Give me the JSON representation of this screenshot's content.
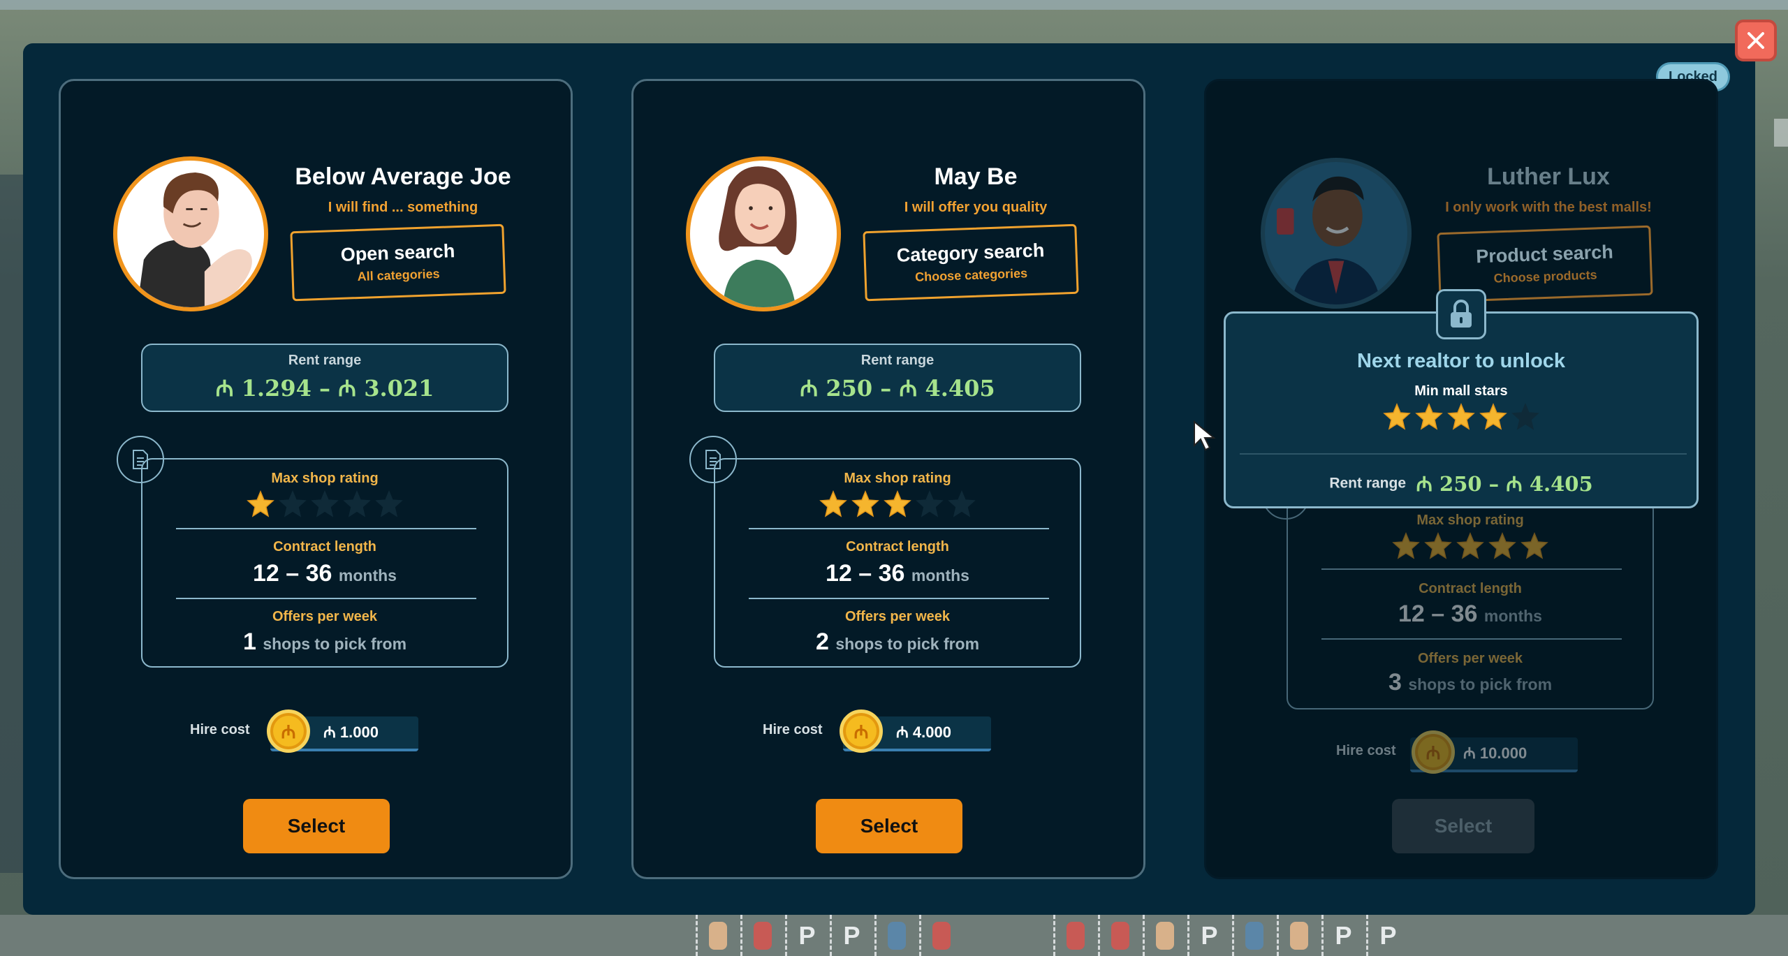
{
  "header": {
    "locked_badge": "Locked"
  },
  "cards": [
    {
      "name": "Below Average Joe",
      "tagline": "I will find ... something",
      "search_title": "Open search",
      "search_sub": "All categories",
      "rent_label": "Rent range",
      "rent_value": "₼ 1.294 – ₼ 3.021",
      "max_shop_rating_label": "Max shop rating",
      "max_shop_rating": 1,
      "contract_label": "Contract length",
      "contract_value": "12 – 36",
      "contract_unit": "months",
      "offers_label": "Offers per week",
      "offers_value": "1",
      "offers_unit": "shops to pick from",
      "hire_label": "Hire cost",
      "hire_value": "₼ 1.000",
      "select_label": "Select"
    },
    {
      "name": "May Be",
      "tagline": "I will offer you quality",
      "search_title": "Category search",
      "search_sub": "Choose categories",
      "rent_label": "Rent range",
      "rent_value": "₼ 250 – ₼ 4.405",
      "max_shop_rating_label": "Max shop rating",
      "max_shop_rating": 3,
      "contract_label": "Contract length",
      "contract_value": "12 – 36",
      "contract_unit": "months",
      "offers_label": "Offers per week",
      "offers_value": "2",
      "offers_unit": "shops to pick from",
      "hire_label": "Hire cost",
      "hire_value": "₼ 4.000",
      "select_label": "Select"
    },
    {
      "name": "Luther Lux",
      "tagline": "I only work with the best malls!",
      "search_title": "Product search",
      "search_sub": "Choose products",
      "max_shop_rating_label": "Max shop rating",
      "max_shop_rating": 5,
      "contract_label": "Contract length",
      "contract_value": "12 – 36",
      "contract_unit": "months",
      "offers_label": "Offers per week",
      "offers_value": "3",
      "offers_unit": "shops to pick from",
      "hire_label": "Hire cost",
      "hire_value": "₼ 10.000",
      "select_label": "Select",
      "locked": true
    }
  ],
  "unlock": {
    "title": "Next realtor to unlock",
    "min_label": "Min mall stars",
    "min_stars": 4,
    "rent_label": "Rent range",
    "rent_value": "₼ 250 – ₼ 4.405"
  },
  "colors": {
    "modal_bg": "#05283a",
    "card_bg": "#031a27",
    "accent_orange": "#f08b12",
    "rent_green": "#a6e38c",
    "label_gold": "#f2b64a",
    "close_red": "#f16a5b"
  },
  "icons": {
    "close": "close-icon",
    "lock": "lock-icon",
    "document": "document-icon",
    "coin": "coin-icon",
    "star": "star-icon"
  }
}
